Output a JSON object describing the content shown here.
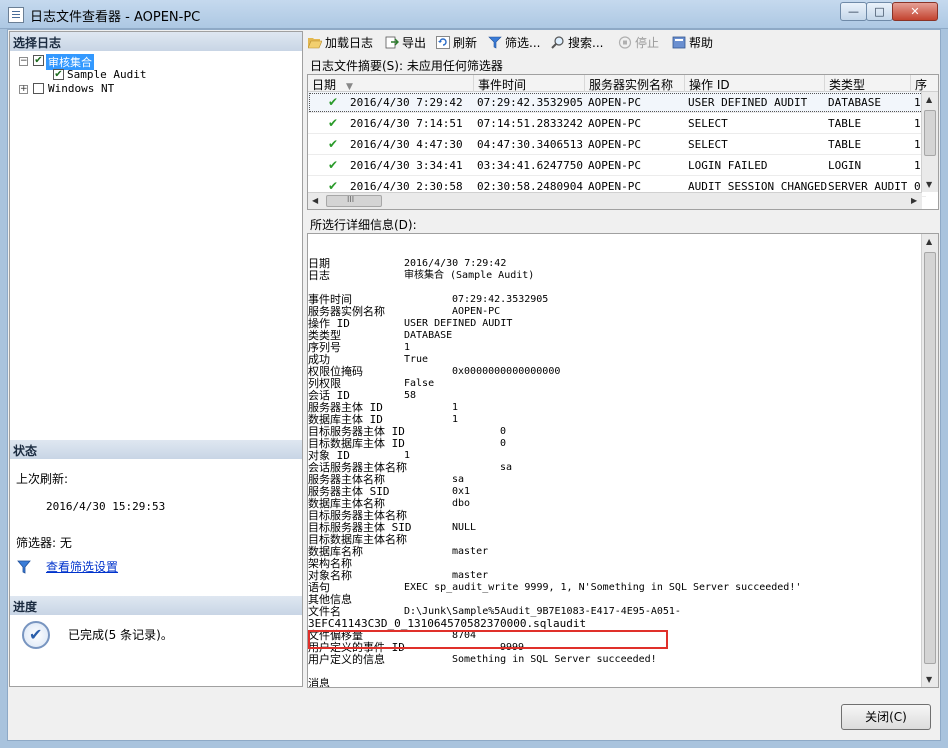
{
  "window": {
    "title": "日志文件查看器 - AOPEN-PC",
    "min_label": "—",
    "max_label": "□",
    "close_label": "✕"
  },
  "left": {
    "select_log_header": "选择日志",
    "tree": [
      {
        "label": "审核集合",
        "expander": "−",
        "checked": true,
        "selected": true
      },
      {
        "label": "Sample Audit",
        "checked": true
      },
      {
        "label": "Windows NT",
        "expander": "+",
        "checked": false
      }
    ],
    "status_header": "状态",
    "last_refresh_label": "上次刷新:",
    "last_refresh_value": "2016/4/30 15:29:53",
    "filter_label": "筛选器: 无",
    "view_filter_link": "查看筛选设置",
    "progress_header": "进度",
    "progress_text": "已完成(5 条记录)。"
  },
  "toolbar": {
    "load": "加载日志",
    "export": "导出",
    "refresh": "刷新",
    "filter": "筛选...",
    "search": "搜索...",
    "stop": "停止",
    "help": "帮助"
  },
  "summary_label": "日志文件摘要(S): 未应用任何筛选器",
  "grid": {
    "columns": [
      "日期",
      "事件时间",
      "服务器实例名称",
      "操作 ID",
      "类类型",
      "序"
    ],
    "rows": [
      [
        "2016/4/30 7:29:42",
        "07:29:42.3532905",
        "AOPEN-PC",
        "USER DEFINED AUDIT",
        "DATABASE",
        "1"
      ],
      [
        "2016/4/30 7:14:51",
        "07:14:51.2833242",
        "AOPEN-PC",
        "SELECT",
        "TABLE",
        "1"
      ],
      [
        "2016/4/30 4:47:30",
        "04:47:30.3406513",
        "AOPEN-PC",
        "SELECT",
        "TABLE",
        "1"
      ],
      [
        "2016/4/30 3:34:41",
        "03:34:41.6247750",
        "AOPEN-PC",
        "LOGIN FAILED",
        "LOGIN",
        "1"
      ],
      [
        "2016/4/30 2:30:58",
        "02:30:58.2480904",
        "AOPEN-PC",
        "AUDIT SESSION CHANGED",
        "SERVER AUDIT",
        "0"
      ]
    ],
    "hscroll_grip": "III"
  },
  "detail_label": "所选行详细信息(D):",
  "details": [
    {
      "k": "日期",
      "v": "2016/4/30 7:29:42"
    },
    {
      "k": "日志",
      "v": "审核集合 (Sample Audit)"
    },
    {
      "k": "",
      "v": ""
    },
    {
      "k": "事件时间",
      "v": "07:29:42.3532905"
    },
    {
      "k": "服务器实例名称",
      "v": "AOPEN-PC"
    },
    {
      "k": "操作 ID",
      "v": "USER DEFINED AUDIT"
    },
    {
      "k": "类类型",
      "v": "DATABASE"
    },
    {
      "k": "序列号",
      "v": "1"
    },
    {
      "k": "成功",
      "v": "True"
    },
    {
      "k": "权限位掩码",
      "v": "0x0000000000000000"
    },
    {
      "k": "列权限",
      "v": "False"
    },
    {
      "k": "会话 ID",
      "v": "58"
    },
    {
      "k": "服务器主体 ID",
      "v": "1"
    },
    {
      "k": "数据库主体 ID",
      "v": "1"
    },
    {
      "k": "目标服务器主体 ID",
      "v": "0"
    },
    {
      "k": "目标数据库主体 ID",
      "v": "0"
    },
    {
      "k": "对象 ID",
      "v": "1"
    },
    {
      "k": "会话服务器主体名称",
      "v": "sa"
    },
    {
      "k": "服务器主体名称",
      "v": "sa"
    },
    {
      "k": "服务器主体 SID",
      "v": "0x1"
    },
    {
      "k": "数据库主体名称",
      "v": "dbo"
    },
    {
      "k": "目标服务器主体名称",
      "v": ""
    },
    {
      "k": "目标服务器主体 SID",
      "v": "NULL"
    },
    {
      "k": "目标数据库主体名称",
      "v": ""
    },
    {
      "k": "数据库名称",
      "v": "master"
    },
    {
      "k": "架构名称",
      "v": ""
    },
    {
      "k": "对象名称",
      "v": "master"
    },
    {
      "k": "语句",
      "v": "EXEC sp_audit_write 9999, 1, N'Something in SQL Server succeeded!'"
    },
    {
      "k": "其他信息",
      "v": ""
    },
    {
      "k": "文件名",
      "v": "D:\\Junk\\Sample%5Audit_9B7E1083-E417-4E95-A051-"
    },
    {
      "k": "3EFC41143C3D_0_131064570582370000.sqlaudit",
      "v": ""
    },
    {
      "k": "文件偏移量",
      "v": "8704"
    },
    {
      "k": "用户定义的事件 ID",
      "v": "9999"
    },
    {
      "k": "用户定义的信息",
      "v": "Something in SQL Server succeeded!"
    },
    {
      "k": "",
      "v": ""
    },
    {
      "k": "消息",
      "v": ""
    }
  ],
  "close_button": "关闭(C)",
  "colors": {
    "accent": "#3399ff",
    "highlight_box": "#e0302a",
    "check": "#2a9a2a"
  }
}
